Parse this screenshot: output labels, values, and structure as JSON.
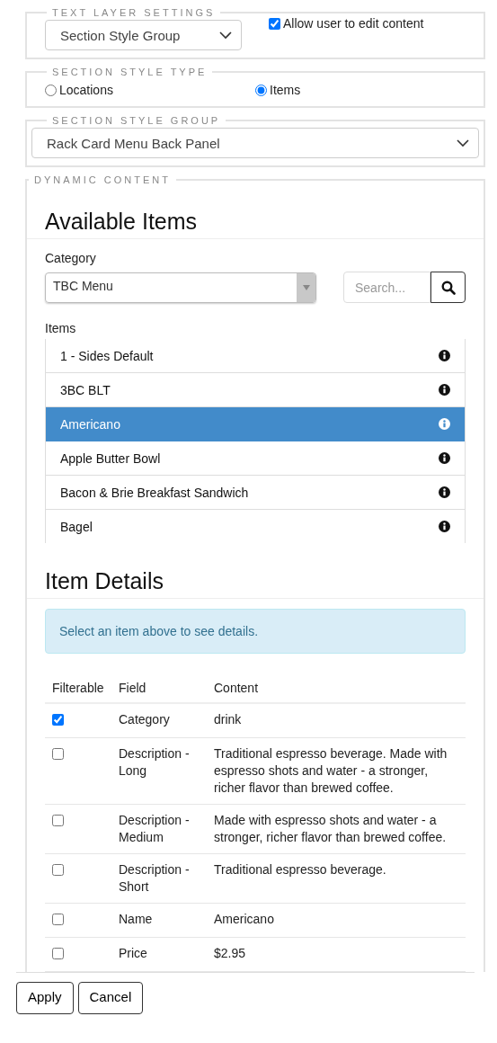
{
  "text_layer_settings": {
    "legend": "TEXT LAYER SETTINGS",
    "style_select": {
      "value": "Section Style Group"
    },
    "allow_edit": {
      "label": "Allow user to edit content",
      "checked": true
    }
  },
  "section_style_type": {
    "legend": "SECTION STYLE TYPE",
    "options": [
      {
        "label": "Locations",
        "selected": false
      },
      {
        "label": "Items",
        "selected": true
      }
    ]
  },
  "section_style_group": {
    "legend": "SECTION STYLE GROUP",
    "select": {
      "value": "Rack Card Menu Back Panel"
    }
  },
  "dynamic_content": {
    "legend": "DYNAMIC CONTENT",
    "available_items": {
      "heading": "Available Items",
      "category_label": "Category",
      "category_select": {
        "value": "TBC Menu"
      },
      "search": {
        "placeholder": "Search..."
      },
      "items_label": "Items",
      "items": [
        {
          "name": "1 - Sides Default",
          "selected": false
        },
        {
          "name": "3BC BLT",
          "selected": false
        },
        {
          "name": "Americano",
          "selected": true
        },
        {
          "name": "Apple Butter Bowl",
          "selected": false
        },
        {
          "name": "Bacon & Brie Breakfast Sandwich",
          "selected": false
        },
        {
          "name": "Bagel",
          "selected": false
        }
      ]
    },
    "item_details": {
      "heading": "Item Details",
      "alert": "Select an item above to see details.",
      "table": {
        "columns": [
          "Filterable",
          "Field",
          "Content"
        ],
        "rows": [
          {
            "filterable": true,
            "field": "Category",
            "content": "drink"
          },
          {
            "filterable": false,
            "field": "Description - Long",
            "content": "Traditional espresso beverage. Made with espresso shots and water - a stronger, richer flavor than brewed coffee."
          },
          {
            "filterable": false,
            "field": "Description - Medium",
            "content": "Made with espresso shots and water - a stronger, richer flavor than brewed coffee."
          },
          {
            "filterable": false,
            "field": "Description - Short",
            "content": "Traditional espresso beverage."
          },
          {
            "filterable": false,
            "field": "Name",
            "content": "Americano"
          },
          {
            "filterable": false,
            "field": "Price",
            "content": "$2.95"
          }
        ]
      }
    }
  },
  "buttons": [
    "Apply",
    "Cancel"
  ]
}
